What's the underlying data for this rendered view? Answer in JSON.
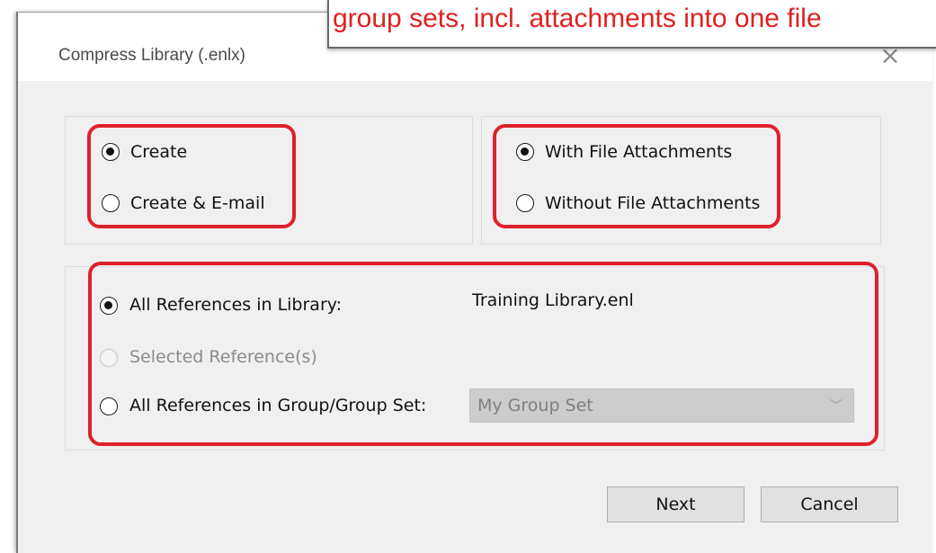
{
  "banner": {
    "text": "group sets, incl. attachments into one file"
  },
  "dialog": {
    "title": "Compress Library (.enlx)",
    "close_glyph": "×"
  },
  "mode_group": {
    "options": [
      {
        "label": "Create",
        "checked": true
      },
      {
        "label": "Create & E-mail",
        "checked": false
      }
    ]
  },
  "attachments_group": {
    "options": [
      {
        "label": "With File Attachments",
        "checked": true
      },
      {
        "label": "Without File Attachments",
        "checked": false
      }
    ]
  },
  "scope_group": {
    "all_refs_label": "All References in Library:",
    "library_name": "Training Library.enl",
    "selected_refs_label": "Selected Reference(s)",
    "group_refs_label": "All References in Group/Group Set:",
    "group_select": {
      "value": "My Group Set",
      "chevron": "﹀"
    }
  },
  "buttons": {
    "next": "Next",
    "cancel": "Cancel"
  },
  "colors": {
    "highlight": "#e0202c",
    "banner_text": "#e02020"
  }
}
